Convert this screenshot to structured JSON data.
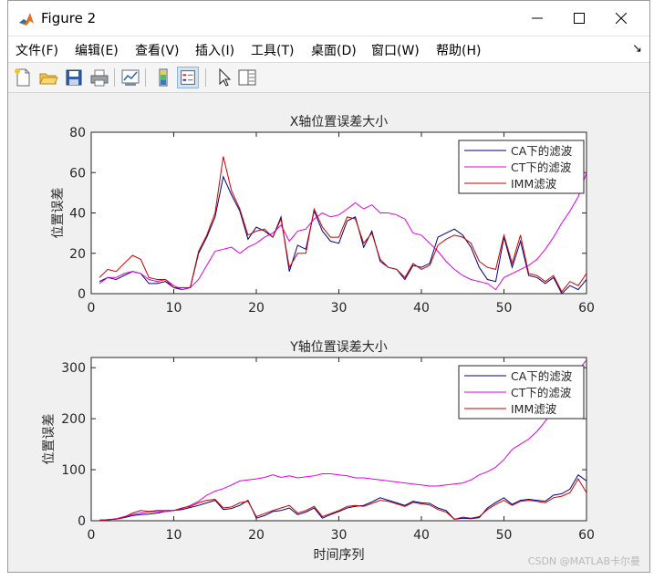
{
  "window": {
    "title": "Figure 2",
    "menu": [
      "文件(F)",
      "编辑(E)",
      "查看(V)",
      "插入(I)",
      "工具(T)",
      "桌面(D)",
      "窗口(W)",
      "帮助(H)"
    ],
    "toolbar_icons": [
      "new-figure-icon",
      "open-folder-icon",
      "save-icon",
      "print-icon",
      "link-plot-icon",
      "colorbar-icon",
      "legend-icon",
      "pointer-icon",
      "property-editor-icon"
    ]
  },
  "watermark": "CSDN @MATLAB卡尔曼",
  "chart_data": [
    {
      "type": "line",
      "title": "X轴位置误差大小",
      "xlabel": "",
      "ylabel": "位置误差",
      "xlim": [
        0,
        60
      ],
      "ylim": [
        0,
        80
      ],
      "xticks": [
        0,
        10,
        20,
        30,
        40,
        50,
        60
      ],
      "yticks": [
        0,
        20,
        40,
        60,
        80
      ],
      "legend_position": "top-right",
      "x": [
        1,
        2,
        3,
        4,
        5,
        6,
        7,
        8,
        9,
        10,
        11,
        12,
        13,
        14,
        15,
        16,
        17,
        18,
        19,
        20,
        21,
        22,
        23,
        24,
        25,
        26,
        27,
        28,
        29,
        30,
        31,
        32,
        33,
        34,
        35,
        36,
        37,
        38,
        39,
        40,
        41,
        42,
        43,
        44,
        45,
        46,
        47,
        48,
        49,
        50,
        51,
        52,
        53,
        54,
        55,
        56,
        57,
        58,
        59,
        60
      ],
      "series": [
        {
          "name": "CA下的滤波",
          "color": "#00007f",
          "values": [
            6,
            8,
            7,
            9,
            11,
            10,
            5,
            5,
            6,
            3,
            2,
            3,
            20,
            28,
            38,
            58,
            49,
            41,
            27,
            33,
            31,
            28,
            38,
            11,
            24,
            22,
            41,
            31,
            26,
            25,
            36,
            38,
            23,
            31,
            16,
            13,
            12,
            7,
            14,
            13,
            15,
            28,
            30,
            32,
            29,
            23,
            13,
            7,
            6,
            28,
            13,
            26,
            9,
            8,
            5,
            8,
            0,
            4,
            2,
            7
          ]
        },
        {
          "name": "CT下的滤波",
          "color": "#e000e0",
          "values": [
            5,
            8,
            8,
            10,
            11,
            10,
            7,
            6,
            7,
            4,
            2,
            3,
            7,
            14,
            21,
            22,
            23,
            20,
            23,
            25,
            28,
            30,
            34,
            26,
            31,
            32,
            37,
            40,
            38,
            39,
            42,
            45,
            42,
            44,
            40,
            40,
            39,
            37,
            30,
            29,
            25,
            21,
            16,
            12,
            9,
            7,
            6,
            5,
            2,
            8,
            10,
            12,
            14,
            17,
            22,
            28,
            35,
            41,
            48,
            60
          ]
        },
        {
          "name": "IMM滤波",
          "color": "#cc0000",
          "values": [
            8,
            12,
            11,
            15,
            19,
            17,
            8,
            7,
            7,
            3,
            3,
            3,
            21,
            29,
            40,
            68,
            51,
            42,
            29,
            31,
            32,
            28,
            37,
            13,
            20,
            20,
            42,
            33,
            28,
            28,
            38,
            37,
            25,
            30,
            17,
            13,
            12,
            8,
            15,
            12,
            14,
            24,
            27,
            29,
            28,
            25,
            16,
            13,
            12,
            29,
            15,
            29,
            10,
            9,
            6,
            9,
            1,
            6,
            4,
            10
          ]
        }
      ]
    },
    {
      "type": "line",
      "title": "Y轴位置误差大小",
      "xlabel": "时间序列",
      "ylabel": "位置误差",
      "xlim": [
        0,
        60
      ],
      "ylim": [
        0,
        320
      ],
      "xticks": [
        0,
        10,
        20,
        30,
        40,
        50,
        60
      ],
      "yticks": [
        0,
        100,
        200,
        300
      ],
      "legend_position": "top-right",
      "x": [
        1,
        2,
        3,
        4,
        5,
        6,
        7,
        8,
        9,
        10,
        11,
        12,
        13,
        14,
        15,
        16,
        17,
        18,
        19,
        20,
        21,
        22,
        23,
        24,
        25,
        26,
        27,
        28,
        29,
        30,
        31,
        32,
        33,
        34,
        35,
        36,
        37,
        38,
        39,
        40,
        41,
        42,
        43,
        44,
        45,
        46,
        47,
        48,
        49,
        50,
        51,
        52,
        53,
        54,
        55,
        56,
        57,
        58,
        59,
        60
      ],
      "series": [
        {
          "name": "CA下的滤波",
          "color": "#00007f",
          "values": [
            1,
            2,
            3,
            6,
            10,
            12,
            13,
            15,
            18,
            20,
            22,
            26,
            30,
            35,
            40,
            22,
            24,
            30,
            40,
            5,
            10,
            18,
            20,
            25,
            12,
            17,
            25,
            5,
            12,
            18,
            25,
            28,
            30,
            37,
            45,
            40,
            35,
            30,
            38,
            35,
            34,
            25,
            20,
            3,
            5,
            4,
            6,
            25,
            36,
            45,
            32,
            40,
            42,
            40,
            38,
            50,
            53,
            62,
            90,
            78
          ]
        },
        {
          "name": "CT下的滤波",
          "color": "#e000e0",
          "values": [
            1,
            2,
            4,
            8,
            12,
            15,
            17,
            18,
            18,
            20,
            24,
            30,
            38,
            50,
            58,
            63,
            70,
            78,
            80,
            82,
            85,
            90,
            85,
            88,
            84,
            86,
            88,
            92,
            92,
            90,
            88,
            84,
            84,
            82,
            80,
            78,
            76,
            74,
            72,
            70,
            68,
            68,
            70,
            72,
            74,
            80,
            90,
            96,
            105,
            120,
            140,
            150,
            160,
            175,
            195,
            215,
            240,
            265,
            295,
            315
          ]
        },
        {
          "name": "IMM滤波",
          "color": "#cc0000",
          "values": [
            1,
            2,
            3,
            7,
            15,
            20,
            18,
            20,
            20,
            20,
            25,
            28,
            35,
            40,
            42,
            25,
            27,
            35,
            38,
            8,
            14,
            20,
            25,
            30,
            15,
            20,
            28,
            8,
            14,
            20,
            28,
            30,
            28,
            34,
            40,
            38,
            33,
            28,
            36,
            33,
            31,
            22,
            17,
            3,
            7,
            5,
            8,
            22,
            32,
            40,
            30,
            38,
            40,
            38,
            35,
            45,
            48,
            55,
            82,
            55
          ]
        }
      ]
    }
  ]
}
